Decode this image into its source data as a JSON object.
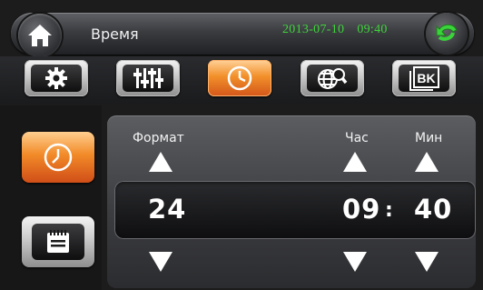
{
  "header": {
    "title": "Время",
    "date": "2013-07-10",
    "time": "09:40",
    "home_icon": "home-icon",
    "back_icon": "back-arrow-icon"
  },
  "tabs": [
    {
      "icon": "gear-icon",
      "active": false
    },
    {
      "icon": "equalizer-icon",
      "active": false
    },
    {
      "icon": "clock-icon",
      "active": true
    },
    {
      "icon": "globe-search-icon",
      "active": false
    },
    {
      "icon": "bk-text-icon",
      "label": "BK",
      "active": false
    }
  ],
  "sidebar": [
    {
      "icon": "clock-icon",
      "active": true
    },
    {
      "icon": "calendar-icon",
      "active": false
    }
  ],
  "settings": {
    "format_label": "Формат",
    "hour_label": "Час",
    "minute_label": "Мин",
    "format_value": "24",
    "hour_value": "09",
    "separator": ":",
    "minute_value": "40"
  },
  "colors": {
    "accent_orange": "#f28a28",
    "datetime_green": "#3fd43a"
  }
}
